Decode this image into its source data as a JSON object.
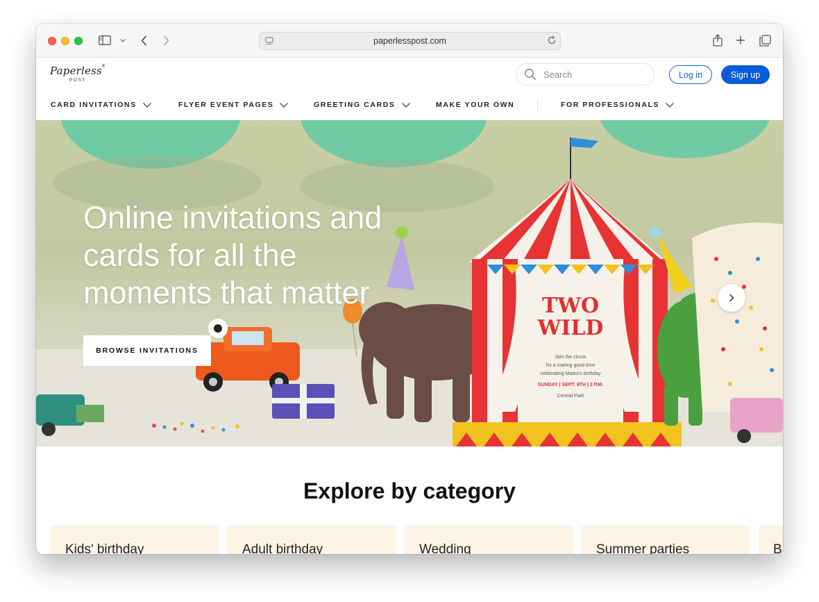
{
  "browser": {
    "url": "paperlesspost.com"
  },
  "logo": {
    "text": "Paperless",
    "subtext": "POST"
  },
  "header": {
    "search_placeholder": "Search",
    "login_label": "Log in",
    "signup_label": "Sign up"
  },
  "nav": {
    "items": [
      {
        "label": "CARD INVITATIONS",
        "has_dropdown": true
      },
      {
        "label": "FLYER EVENT PAGES",
        "has_dropdown": true
      },
      {
        "label": "GREETING CARDS",
        "has_dropdown": true
      },
      {
        "label": "MAKE YOUR OWN",
        "has_dropdown": false
      },
      {
        "label": "FOR PROFESSIONALS",
        "has_dropdown": true
      }
    ]
  },
  "hero": {
    "title": "Online invitations and cards for all the moments that matter",
    "cta_label": "BROWSE INVITATIONS",
    "card": {
      "headline_1": "TWO",
      "headline_2": "WILD",
      "line_1": "Join the circus",
      "line_2": "for a roaring good time",
      "line_3": "celebrating Mateo's birthday",
      "date_line": "SUNDAY | SEPT. 8TH | 3 P.M.",
      "location": "Central Park"
    }
  },
  "explore": {
    "title": "Explore by category",
    "categories": [
      {
        "label": "Kids' birthday"
      },
      {
        "label": "Adult birthday"
      },
      {
        "label": "Wedding"
      },
      {
        "label": "Summer parties"
      },
      {
        "label": "B"
      }
    ]
  },
  "colors": {
    "primary_blue": "#0a5bd8",
    "category_bg": "#fdf4e6",
    "hero_bg": "#c6cca2"
  }
}
